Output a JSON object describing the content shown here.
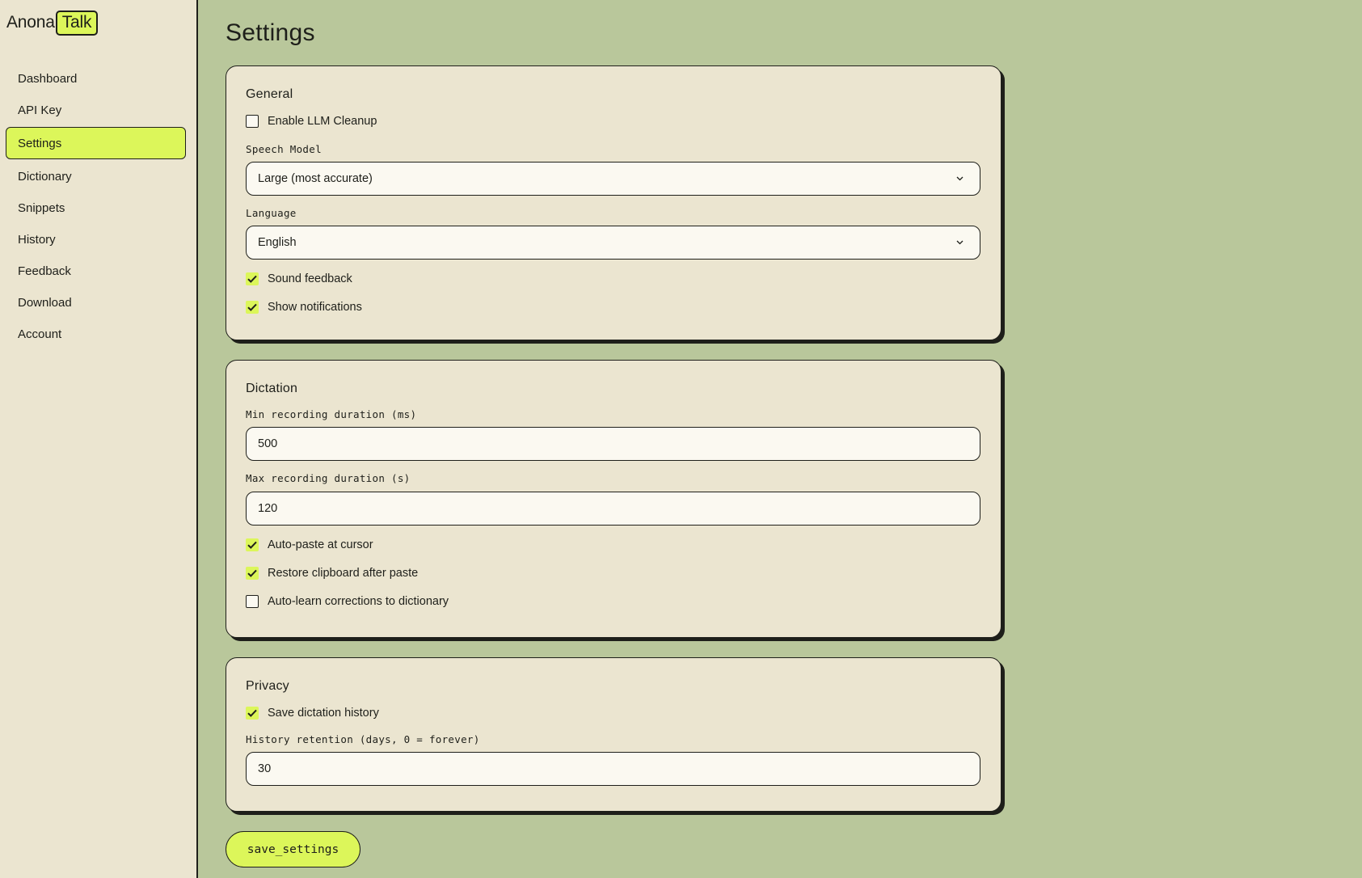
{
  "brand": {
    "part1": "Anona",
    "part2": "Talk"
  },
  "sidebar": {
    "items": [
      {
        "label": "Dashboard",
        "active": false
      },
      {
        "label": "API Key",
        "active": false
      },
      {
        "label": "Settings",
        "active": true
      },
      {
        "label": "Dictionary",
        "active": false
      },
      {
        "label": "Snippets",
        "active": false
      },
      {
        "label": "History",
        "active": false
      },
      {
        "label": "Feedback",
        "active": false
      },
      {
        "label": "Download",
        "active": false
      },
      {
        "label": "Account",
        "active": false
      }
    ]
  },
  "page": {
    "title": "Settings"
  },
  "general": {
    "title": "General",
    "llm_cleanup": {
      "label": "Enable LLM Cleanup",
      "checked": false
    },
    "speech_model": {
      "label": "Speech Model",
      "value": "Large (most accurate)"
    },
    "language": {
      "label": "Language",
      "value": "English"
    },
    "sound_feedback": {
      "label": "Sound feedback",
      "checked": true
    },
    "show_notifications": {
      "label": "Show notifications",
      "checked": true
    }
  },
  "dictation": {
    "title": "Dictation",
    "min_duration": {
      "label": "Min recording duration (ms)",
      "value": "500"
    },
    "max_duration": {
      "label": "Max recording duration (s)",
      "value": "120"
    },
    "auto_paste": {
      "label": "Auto-paste at cursor",
      "checked": true
    },
    "restore_clipboard": {
      "label": "Restore clipboard after paste",
      "checked": true
    },
    "auto_learn": {
      "label": "Auto-learn corrections to dictionary",
      "checked": false
    }
  },
  "privacy": {
    "title": "Privacy",
    "save_history": {
      "label": "Save dictation history",
      "checked": true
    },
    "retention": {
      "label": "History retention (days, 0 = forever)",
      "value": "30"
    }
  },
  "save_button": {
    "label": "save_settings"
  },
  "colors": {
    "accent": "#dcf65a",
    "background": "#b9c79b",
    "panel": "#ebe5d0",
    "input": "#fbf9f1",
    "ink": "#1e1f1a"
  },
  "icons": {
    "checkbox_checked": "checkmark-icon",
    "select_caret": "chevron-down-icon"
  }
}
